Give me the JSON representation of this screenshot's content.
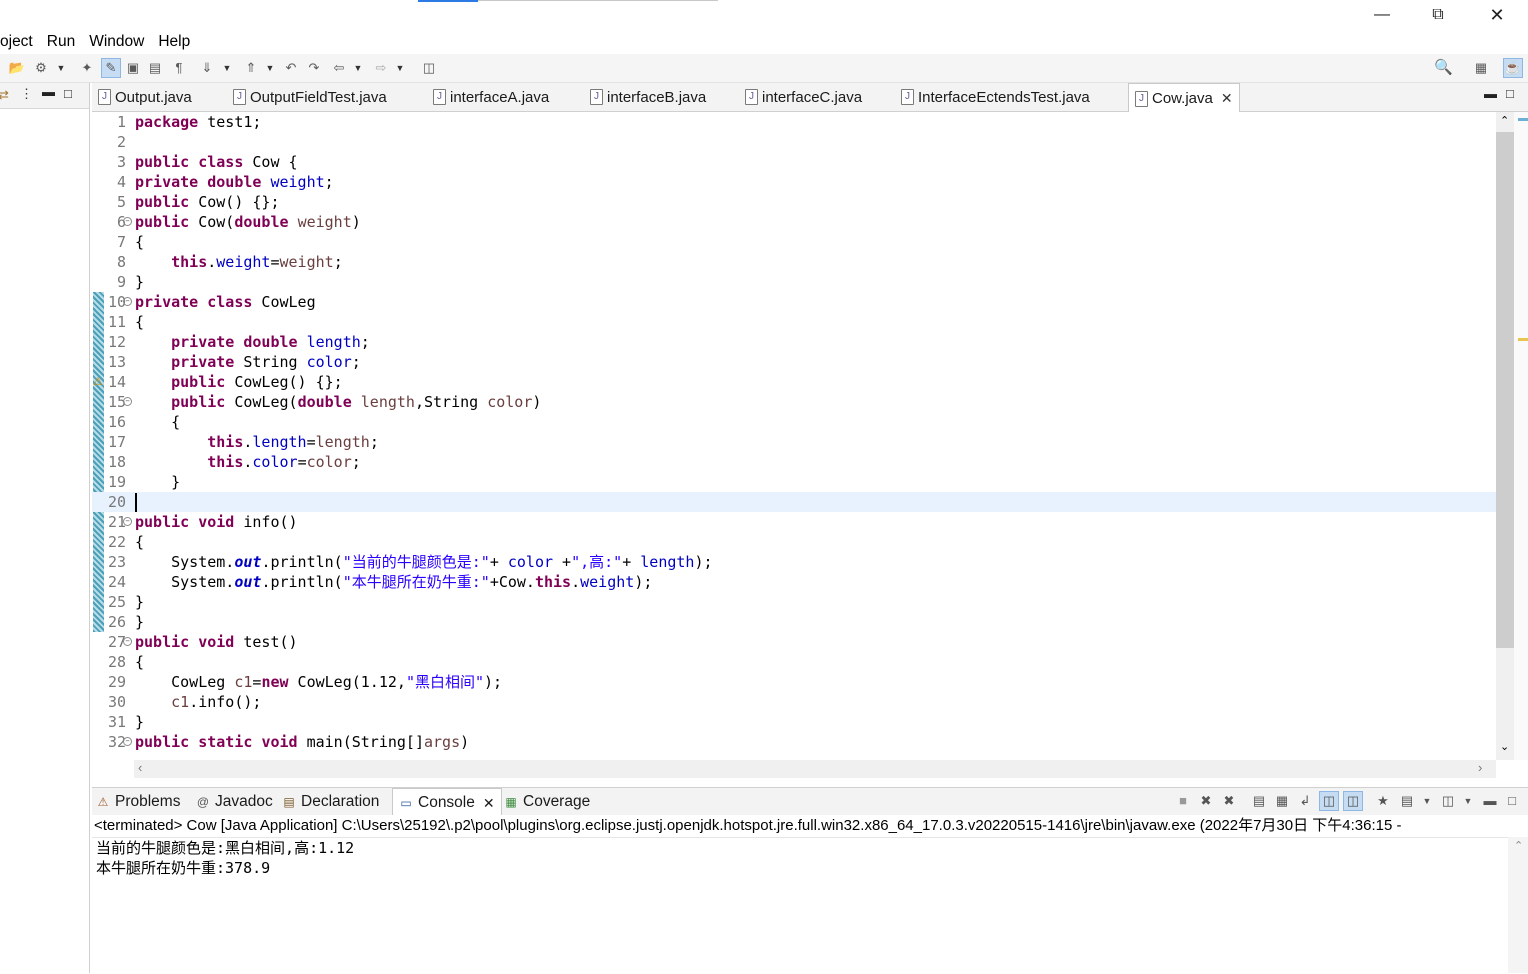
{
  "window": {
    "minimize_icon": "minimize-icon",
    "restore_icon": "restore-icon",
    "close_icon": "close-icon"
  },
  "menu": [
    "oject",
    "Run",
    "Window",
    "Help"
  ],
  "editor_tabs": [
    {
      "label": "Output.java",
      "active": false
    },
    {
      "label": "OutputFieldTest.java",
      "active": false
    },
    {
      "label": "interfaceA.java",
      "active": false
    },
    {
      "label": "interfaceB.java",
      "active": false
    },
    {
      "label": "interfaceC.java",
      "active": false
    },
    {
      "label": "InterfaceEctendsTest.java",
      "active": false
    },
    {
      "label": "Cow.java",
      "active": true
    }
  ],
  "code_lines": [
    {
      "n": "1",
      "html": "<span class=\"kw\">package</span> test1;"
    },
    {
      "n": "2",
      "html": ""
    },
    {
      "n": "3",
      "html": "<span class=\"kw\">public</span> <span class=\"kw\">class</span> Cow {"
    },
    {
      "n": "4",
      "html": "<span class=\"kw\">private</span> <span class=\"kw\">double</span> <span class=\"fld\">weight</span>;"
    },
    {
      "n": "5",
      "html": "<span class=\"kw\">public</span> Cow() {};"
    },
    {
      "n": "6",
      "fold": true,
      "html": "<span class=\"kw\">public</span> Cow(<span class=\"kw\">double</span> <span class=\"lv\">weight</span>)"
    },
    {
      "n": "7",
      "html": "{"
    },
    {
      "n": "8",
      "html": "    <span class=\"kw\">this</span>.<span class=\"fld\">weight</span>=<span class=\"lv\">weight</span>;"
    },
    {
      "n": "9",
      "html": "}"
    },
    {
      "n": "10",
      "fold": true,
      "html": "<span class=\"kw\">private</span> <span class=\"kw\">class</span> CowLeg"
    },
    {
      "n": "11",
      "html": "{"
    },
    {
      "n": "12",
      "html": "    <span class=\"kw\">private</span> <span class=\"kw\">double</span> <span class=\"fld\">length</span>;"
    },
    {
      "n": "13",
      "html": "    <span class=\"kw\">private</span> String <span class=\"fld\">color</span>;"
    },
    {
      "n": "14",
      "html": "    <span class=\"kw\">public</span> CowLeg() {};"
    },
    {
      "n": "15",
      "fold": true,
      "html": "    <span class=\"kw\">public</span> CowLeg(<span class=\"kw\">double</span> <span class=\"lv\">length</span>,String <span class=\"lv\">color</span>)"
    },
    {
      "n": "16",
      "html": "    {"
    },
    {
      "n": "17",
      "html": "        <span class=\"kw\">this</span>.<span class=\"fld\">length</span>=<span class=\"lv\">length</span>;"
    },
    {
      "n": "18",
      "html": "        <span class=\"kw\">this</span>.<span class=\"fld\">color</span>=<span class=\"lv\">color</span>;"
    },
    {
      "n": "19",
      "html": "    }"
    },
    {
      "n": "20",
      "current": true,
      "html": ""
    },
    {
      "n": "21",
      "fold": true,
      "html": "<span class=\"kw\">public</span> <span class=\"kw\">void</span> info()"
    },
    {
      "n": "22",
      "html": "{"
    },
    {
      "n": "23",
      "html": "    System.<span class=\"sf\">out</span>.println(<span class=\"str\">\"当前的牛腿颜色是:\"</span>+ <span class=\"fld\">color</span> +<span class=\"str\">\",高:\"</span>+ <span class=\"fld\">length</span>);"
    },
    {
      "n": "24",
      "html": "    System.<span class=\"sf\">out</span>.println(<span class=\"str\">\"本牛腿所在奶牛重:\"</span>+Cow.<span class=\"kw\">this</span>.<span class=\"fld\">weight</span>);"
    },
    {
      "n": "25",
      "html": "}"
    },
    {
      "n": "26",
      "html": "}"
    },
    {
      "n": "27",
      "fold": true,
      "html": "<span class=\"kw\">public</span> <span class=\"kw\">void</span> test()"
    },
    {
      "n": "28",
      "html": "{"
    },
    {
      "n": "29",
      "html": "    CowLeg <span class=\"lv\">c1</span>=<span class=\"kw\">new</span> CowLeg(1.12,<span class=\"str\">\"黑白相间\"</span>);"
    },
    {
      "n": "30",
      "html": "    <span class=\"lv\">c1</span>.info();"
    },
    {
      "n": "31",
      "html": "}"
    },
    {
      "n": "32",
      "fold": true,
      "html": "<span class=\"kw\">public</span> <span class=\"kw\">static</span> <span class=\"kw\">void</span> main(String[]<span class=\"lv\">args</span>)"
    }
  ],
  "bottom_tabs": [
    {
      "label": "Problems",
      "icon": "problems-icon",
      "glyph": "⚠",
      "active": false
    },
    {
      "label": "Javadoc",
      "icon": "javadoc-icon",
      "glyph": "@",
      "active": false
    },
    {
      "label": "Declaration",
      "icon": "declaration-icon",
      "glyph": "▤",
      "active": false
    },
    {
      "label": "Console",
      "icon": "console-icon",
      "glyph": "▭",
      "active": true
    },
    {
      "label": "Coverage",
      "icon": "coverage-icon",
      "glyph": "▦",
      "active": false
    }
  ],
  "console": {
    "status": "<terminated> Cow [Java Application] C:\\Users\\25192\\.p2\\pool\\plugins\\org.eclipse.justj.openjdk.hotspot.jre.full.win32.x86_64_17.0.3.v20220515-1416\\jre\\bin\\javaw.exe  (2022年7月30日 下午4:36:15 -",
    "output": [
      "当前的牛腿颜色是:黑白相间,高:1.12",
      "本牛腿所在奶牛重:378.9"
    ]
  },
  "colors": {
    "keyword": "#7f0055",
    "field": "#0000c0",
    "string": "#2a00ff",
    "local_var": "#6a3e3e",
    "current_line": "#e8f2fe"
  }
}
